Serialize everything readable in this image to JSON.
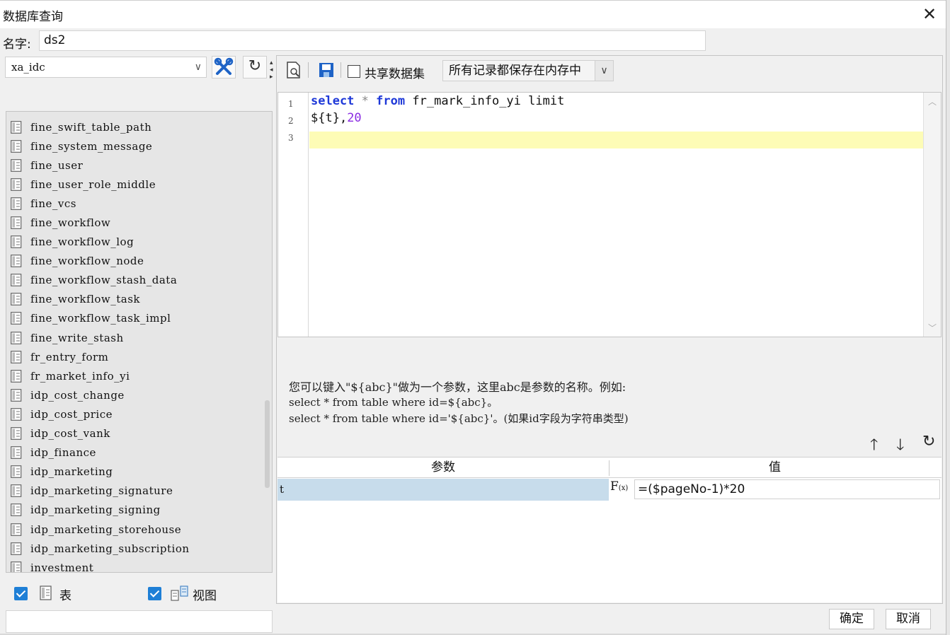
{
  "window": {
    "title": "数据库查询",
    "close_glyph": "✕"
  },
  "name_field": {
    "label": "名字:",
    "value": "ds2"
  },
  "connection": {
    "selected": "xa_idc",
    "chevron": "∨"
  },
  "tables": [
    "fine_swift_table_path",
    "fine_system_message",
    "fine_user",
    "fine_user_role_middle",
    "fine_vcs",
    "fine_workflow",
    "fine_workflow_log",
    "fine_workflow_node",
    "fine_workflow_stash_data",
    "fine_workflow_task",
    "fine_workflow_task_impl",
    "fine_write_stash",
    "fr_entry_form",
    "fr_market_info_yi",
    "idp_cost_change",
    "idp_cost_price",
    "idp_cost_vank",
    "idp_finance",
    "idp_marketing",
    "idp_marketing_signature",
    "idp_marketing_signing",
    "idp_marketing_storehouse",
    "idp_marketing_subscription",
    "investment"
  ],
  "filters": {
    "table_label": "表",
    "view_label": "视图"
  },
  "toolbar": {
    "share_label": "共享数据集",
    "cache_mode": "所有记录都保存在内存中",
    "chevron": "∨"
  },
  "editor": {
    "line_numbers": [
      "1",
      "2",
      "3"
    ],
    "line1": {
      "kw_select": "select",
      "star": "*",
      "kw_from": "from",
      "rest": "fr_mark_info_yi limit"
    },
    "line2": {
      "param": "${t},",
      "num": "20"
    }
  },
  "hint": {
    "line1": "您可以键入\"${abc}\"做为一个参数，这里abc是参数的名称。例如:",
    "line2": "select * from table where id=${abc}。",
    "line3": "select * from table where id='${abc}'。(如果id字段为字符串类型)"
  },
  "param_table": {
    "col_param": "参数",
    "col_value": "值",
    "rows": [
      {
        "name": "t",
        "value": "=($pageNo-1)*20"
      }
    ],
    "fx_label": "F",
    "fx_sub": "(x)"
  },
  "actions": {
    "up": "🡑",
    "down": "🡓",
    "refresh": "↻"
  },
  "footer": {
    "ok": "确定",
    "cancel": "取消"
  },
  "colors": {
    "accent_blue": "#1e7fd6",
    "keyword": "#1f39d8",
    "number": "#8a2be2",
    "current_line": "#fdfcb6",
    "selected_row": "#c7dceb"
  }
}
